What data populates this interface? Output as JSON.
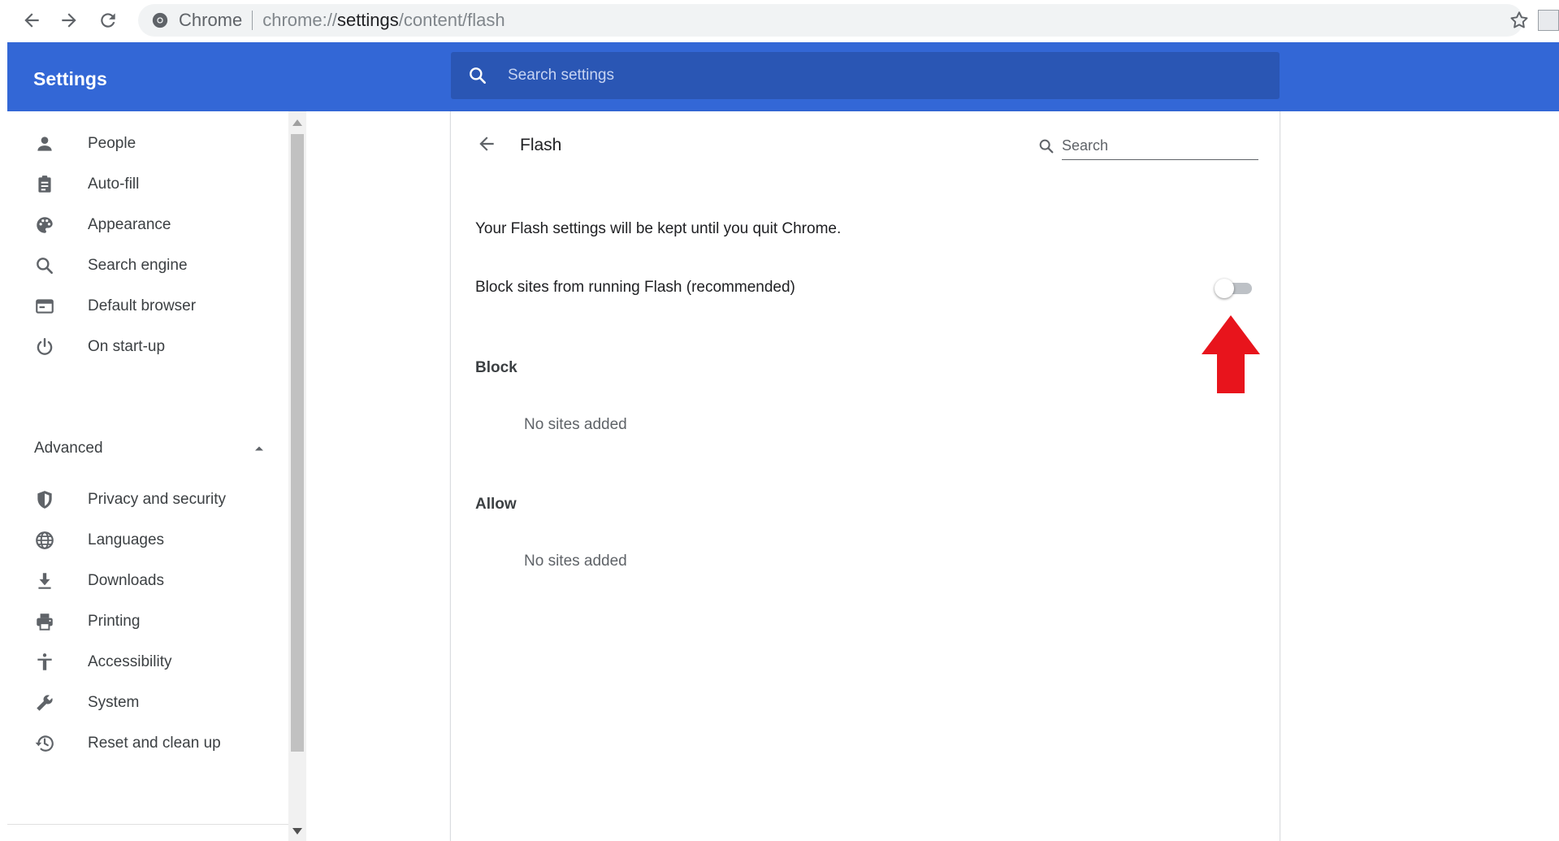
{
  "browser": {
    "site_name": "Chrome",
    "url_scheme": "chrome://",
    "url_host": "settings",
    "url_path": "/content/flash"
  },
  "header": {
    "title": "Settings",
    "search_placeholder": "Search settings"
  },
  "sidebar": {
    "items": [
      {
        "label": "People",
        "icon": "person-icon"
      },
      {
        "label": "Auto-fill",
        "icon": "clipboard-icon"
      },
      {
        "label": "Appearance",
        "icon": "palette-icon"
      },
      {
        "label": "Search engine",
        "icon": "search-icon"
      },
      {
        "label": "Default browser",
        "icon": "browser-window-icon"
      },
      {
        "label": "On start-up",
        "icon": "power-icon"
      }
    ],
    "advanced_label": "Advanced",
    "advanced_items": [
      {
        "label": "Privacy and security",
        "icon": "shield-icon"
      },
      {
        "label": "Languages",
        "icon": "globe-icon"
      },
      {
        "label": "Downloads",
        "icon": "download-icon"
      },
      {
        "label": "Printing",
        "icon": "printer-icon"
      },
      {
        "label": "Accessibility",
        "icon": "accessibility-icon"
      },
      {
        "label": "System",
        "icon": "wrench-icon"
      },
      {
        "label": "Reset and clean up",
        "icon": "history-icon"
      }
    ]
  },
  "content": {
    "title": "Flash",
    "search_placeholder": "Search",
    "info": "Your Flash settings will be kept until you quit Chrome.",
    "block_toggle_label": "Block sites from running Flash (recommended)",
    "block_toggle_on": false,
    "block_section": {
      "title": "Block",
      "empty": "No sites added"
    },
    "allow_section": {
      "title": "Allow",
      "empty": "No sites added"
    }
  },
  "colors": {
    "header_blue": "#3367d6",
    "search_blue": "#2a56b4",
    "annotation_red": "#e8141c"
  }
}
